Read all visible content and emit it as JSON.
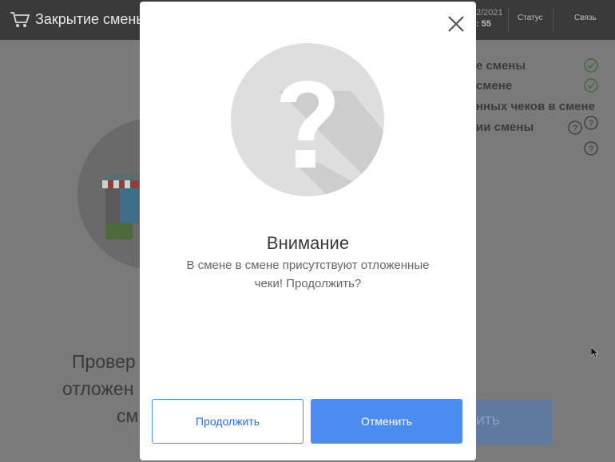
{
  "header": {
    "title": "Закрытие смены",
    "date": "2/2021",
    "time": ": 55",
    "status_label": "Статус",
    "connection_label": "Связь"
  },
  "checklist": {
    "items": [
      {
        "label": "е смены",
        "state": "ok"
      },
      {
        "label": "смене",
        "state": "ok"
      },
      {
        "label": "нных чеков в смене",
        "state": "unknown"
      },
      {
        "label": "ии смены",
        "state": "unknown"
      },
      {
        "label": "",
        "state": "unknown"
      }
    ]
  },
  "main": {
    "line1": "Провер",
    "line2": "отложен",
    "line3": "см",
    "close_button_label": "ИТЬ"
  },
  "dialog": {
    "title": "Внимание",
    "message_line1": "В смене в смене присутствуют отложенные",
    "message_line2": "чеки! Продолжить?",
    "continue_label": "Продолжить",
    "cancel_label": "Отменить"
  },
  "colors": {
    "primary": "#4a8cf0",
    "overlay": "#7a7a7a",
    "ok": "#4caf50"
  }
}
